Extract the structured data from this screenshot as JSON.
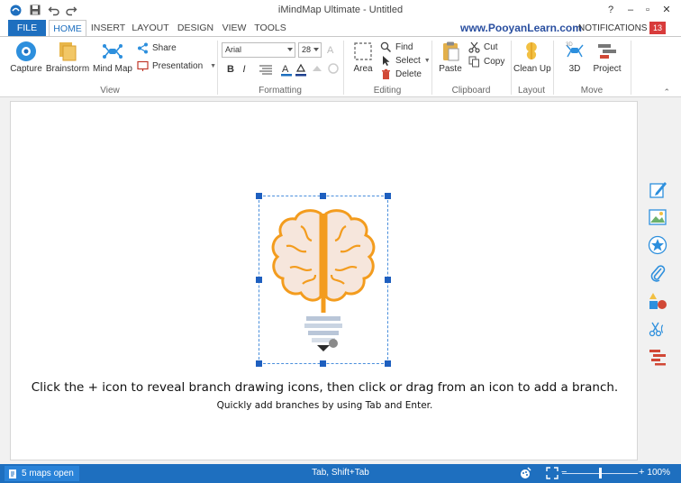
{
  "window": {
    "title": "iMindMap Ultimate - Untitled",
    "controls": [
      "?",
      "–",
      "▫",
      "✕"
    ]
  },
  "quick_access": [
    "save-icon",
    "undo-icon",
    "redo-icon"
  ],
  "tabs": {
    "file": "FILE",
    "items": [
      "HOME",
      "INSERT",
      "LAYOUT",
      "DESIGN",
      "VIEW",
      "TOOLS"
    ],
    "active": "HOME"
  },
  "site_link": "www.PooyanLearn.com",
  "notifications": {
    "label": "NOTIFICATIONS",
    "count": "13"
  },
  "ribbon": {
    "view": {
      "label": "View",
      "capture": "Capture",
      "brainstorm": "Brainstorm",
      "mindmap": "Mind Map",
      "share": "Share",
      "presentation": "Presentation"
    },
    "formatting": {
      "label": "Formatting",
      "font": "Arial",
      "size": "28",
      "bold": "B",
      "italic": "I"
    },
    "editing": {
      "label": "Editing",
      "area": "Area",
      "find": "Find",
      "select": "Select",
      "delete": "Delete"
    },
    "clipboard": {
      "label": "Clipboard",
      "paste": "Paste",
      "cut": "Cut",
      "copy": "Copy"
    },
    "layout": {
      "label": "Layout",
      "cleanup": "Clean Up"
    },
    "move": {
      "label": "Move",
      "three_d": "3D",
      "project": "Project"
    }
  },
  "canvas": {
    "hint_primary": "Click the + icon to reveal branch drawing icons, then click or drag from an icon to add a branch.",
    "hint_secondary": "Quickly add branches by using Tab and Enter."
  },
  "right_panel": [
    "pencil-icon",
    "image-icon",
    "star-icon",
    "paperclip-icon",
    "shapes-icon",
    "scissors-icon",
    "gantt-icon"
  ],
  "statusbar": {
    "maps_open": "5 maps open",
    "shortcut": "Tab, Shift+Tab",
    "zoom": "100%",
    "zoom_level": 0.5
  },
  "colors": {
    "accent": "#1e6fbf",
    "badge": "#d83b3b",
    "selection": "#4a8fdc",
    "brain_outline": "#f39c1e",
    "brain_fill": "#f6e6dc"
  }
}
